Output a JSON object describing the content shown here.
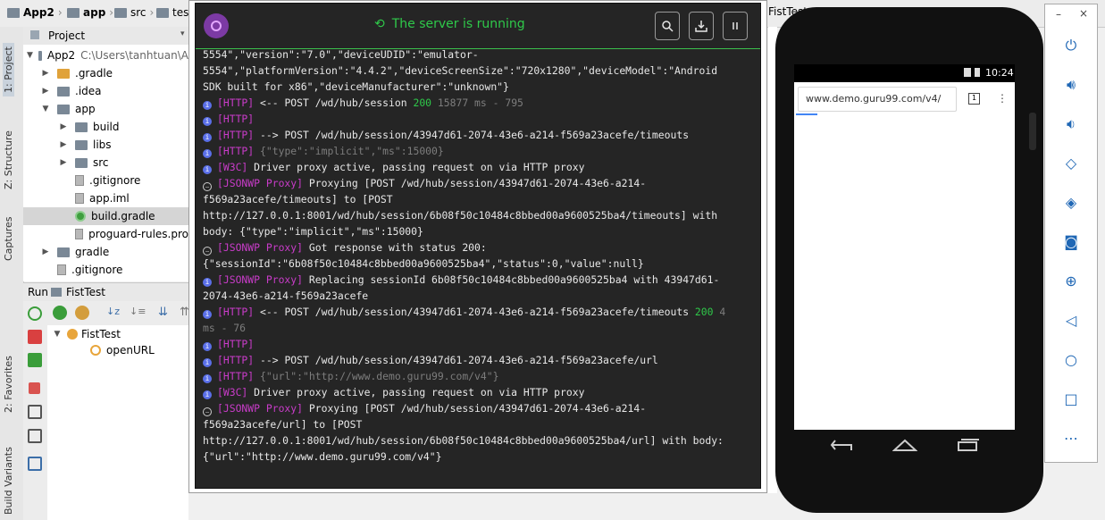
{
  "ide": {
    "breadcrumbs": [
      "App2",
      "app",
      "src",
      "test"
    ],
    "project_panel_label": "Project",
    "project_root": {
      "name": "App2",
      "path": "C:\\Users\\tanhtuan\\A"
    },
    "tree": [
      {
        "label": ".gradle",
        "depth": 1,
        "kind": "folder-orange",
        "arrow": "right"
      },
      {
        "label": ".idea",
        "depth": 1,
        "kind": "folder",
        "arrow": "right"
      },
      {
        "label": "app",
        "depth": 1,
        "kind": "folder",
        "arrow": "down"
      },
      {
        "label": "build",
        "depth": 2,
        "kind": "folder",
        "arrow": "right"
      },
      {
        "label": "libs",
        "depth": 2,
        "kind": "folder",
        "arrow": "right"
      },
      {
        "label": "src",
        "depth": 2,
        "kind": "folder",
        "arrow": "right"
      },
      {
        "label": ".gitignore",
        "depth": 2,
        "kind": "file",
        "arrow": ""
      },
      {
        "label": "app.iml",
        "depth": 2,
        "kind": "file",
        "arrow": ""
      },
      {
        "label": "build.gradle",
        "depth": 2,
        "kind": "gradle",
        "arrow": "",
        "selected": true
      },
      {
        "label": "proguard-rules.pro",
        "depth": 2,
        "kind": "file",
        "arrow": ""
      },
      {
        "label": "gradle",
        "depth": 1,
        "kind": "folder",
        "arrow": "right"
      },
      {
        "label": ".gitignore",
        "depth": 1,
        "kind": "file",
        "arrow": ""
      }
    ],
    "run_label": "Run",
    "run_config": "FistTest",
    "run_tree": [
      "FistTest",
      "openURL"
    ],
    "left_tabs": [
      "1: Project",
      "Z: Structure",
      "Captures",
      "2: Favorites",
      "Build Variants"
    ],
    "editor_tab": "FistTest"
  },
  "appium": {
    "status": "The server is running",
    "buttons": [
      "search-icon",
      "download-icon",
      "pause-icon"
    ],
    "log": [
      {
        "icon": "",
        "parts": [
          {
            "t": "5554\",\"version\":\"7.0\",\"deviceUDID\":\"emulator-",
            "c": ""
          }
        ]
      },
      {
        "icon": "",
        "parts": [
          {
            "t": "5554\",\"platformVersion\":\"4.4.2\",\"deviceScreenSize\":\"720x1280\",\"deviceModel\":\"Android",
            "c": ""
          }
        ]
      },
      {
        "icon": "",
        "parts": [
          {
            "t": "SDK built for x86\",\"deviceManufacturer\":\"unknown\"}",
            "c": ""
          }
        ]
      },
      {
        "icon": "info",
        "parts": [
          {
            "t": "[HTTP]",
            "c": "tag"
          },
          {
            "t": " <-- POST /wd/hub/session ",
            "c": ""
          },
          {
            "t": "200",
            "c": "ok"
          },
          {
            "t": " 15877 ms - 795",
            "c": "dim"
          }
        ]
      },
      {
        "icon": "info",
        "parts": [
          {
            "t": "[HTTP]",
            "c": "tag"
          }
        ]
      },
      {
        "icon": "info",
        "parts": [
          {
            "t": "[HTTP]",
            "c": "tag"
          },
          {
            "t": " --> POST /wd/hub/session/43947d61-2074-43e6-a214-f569a23acefe/timeouts",
            "c": ""
          }
        ]
      },
      {
        "icon": "info",
        "parts": [
          {
            "t": "[HTTP]",
            "c": "tag"
          },
          {
            "t": " {\"type\":\"implicit\",\"ms\":15000}",
            "c": "dim"
          }
        ]
      },
      {
        "icon": "info",
        "parts": [
          {
            "t": "[W3C]",
            "c": "tag"
          },
          {
            "t": " Driver proxy active, passing request on via HTTP proxy",
            "c": ""
          }
        ]
      },
      {
        "icon": "ell",
        "parts": [
          {
            "t": "[JSONWP Proxy]",
            "c": "tag"
          },
          {
            "t": " Proxying [POST /wd/hub/session/43947d61-2074-43e6-a214-",
            "c": ""
          }
        ]
      },
      {
        "icon": "",
        "parts": [
          {
            "t": "f569a23acefe/timeouts] to [POST",
            "c": ""
          }
        ]
      },
      {
        "icon": "",
        "parts": [
          {
            "t": "http://127.0.0.1:8001/wd/hub/session/6b08f50c10484c8bbed00a9600525ba4/timeouts] with",
            "c": ""
          }
        ]
      },
      {
        "icon": "",
        "parts": [
          {
            "t": "body: {\"type\":\"implicit\",\"ms\":15000}",
            "c": ""
          }
        ]
      },
      {
        "icon": "ell",
        "parts": [
          {
            "t": "[JSONWP Proxy]",
            "c": "tag"
          },
          {
            "t": " Got response with status 200:",
            "c": ""
          }
        ]
      },
      {
        "icon": "",
        "parts": [
          {
            "t": "{\"sessionId\":\"6b08f50c10484c8bbed00a9600525ba4\",\"status\":0,\"value\":null}",
            "c": ""
          }
        ]
      },
      {
        "icon": "info",
        "parts": [
          {
            "t": "[JSONWP Proxy]",
            "c": "tag"
          },
          {
            "t": " Replacing sessionId 6b08f50c10484c8bbed00a9600525ba4 with 43947d61-",
            "c": ""
          }
        ]
      },
      {
        "icon": "",
        "parts": [
          {
            "t": "2074-43e6-a214-f569a23acefe",
            "c": ""
          }
        ]
      },
      {
        "icon": "info",
        "parts": [
          {
            "t": "[HTTP]",
            "c": "tag"
          },
          {
            "t": " <-- POST /wd/hub/session/43947d61-2074-43e6-a214-f569a23acefe/timeouts ",
            "c": ""
          },
          {
            "t": "200",
            "c": "ok"
          },
          {
            "t": " 4",
            "c": "dim"
          }
        ]
      },
      {
        "icon": "",
        "parts": [
          {
            "t": "ms - 76",
            "c": "dim"
          }
        ]
      },
      {
        "icon": "info",
        "parts": [
          {
            "t": "[HTTP]",
            "c": "tag"
          }
        ]
      },
      {
        "icon": "info",
        "parts": [
          {
            "t": "[HTTP]",
            "c": "tag"
          },
          {
            "t": " --> POST /wd/hub/session/43947d61-2074-43e6-a214-f569a23acefe/url",
            "c": ""
          }
        ]
      },
      {
        "icon": "info",
        "parts": [
          {
            "t": "[HTTP]",
            "c": "tag"
          },
          {
            "t": " {\"url\":\"http://www.demo.guru99.com/v4\"}",
            "c": "dim"
          }
        ]
      },
      {
        "icon": "info",
        "parts": [
          {
            "t": "[W3C]",
            "c": "tag"
          },
          {
            "t": " Driver proxy active, passing request on via HTTP proxy",
            "c": ""
          }
        ]
      },
      {
        "icon": "ell",
        "parts": [
          {
            "t": "[JSONWP Proxy]",
            "c": "tag"
          },
          {
            "t": " Proxying [POST /wd/hub/session/43947d61-2074-43e6-a214-",
            "c": ""
          }
        ]
      },
      {
        "icon": "",
        "parts": [
          {
            "t": "f569a23acefe/url] to [POST",
            "c": ""
          }
        ]
      },
      {
        "icon": "",
        "parts": [
          {
            "t": "http://127.0.0.1:8001/wd/hub/session/6b08f50c10484c8bbed00a9600525ba4/url] with body:",
            "c": ""
          }
        ]
      },
      {
        "icon": "",
        "parts": [
          {
            "t": "{\"url\":\"http://www.demo.guru99.com/v4\"}",
            "c": ""
          }
        ]
      }
    ]
  },
  "phone": {
    "time": "10:24",
    "url": "www.demo.guru99.com/v4/",
    "tab_count": "1"
  },
  "emulator_toolbar": {
    "minimize": "–",
    "close": "×",
    "buttons": [
      "power-icon",
      "volume-up-icon",
      "volume-down-icon",
      "rotate-left-icon",
      "rotate-right-icon",
      "camera-icon",
      "zoom-icon",
      "back-icon",
      "home-icon",
      "overview-icon",
      "more-icon"
    ]
  }
}
